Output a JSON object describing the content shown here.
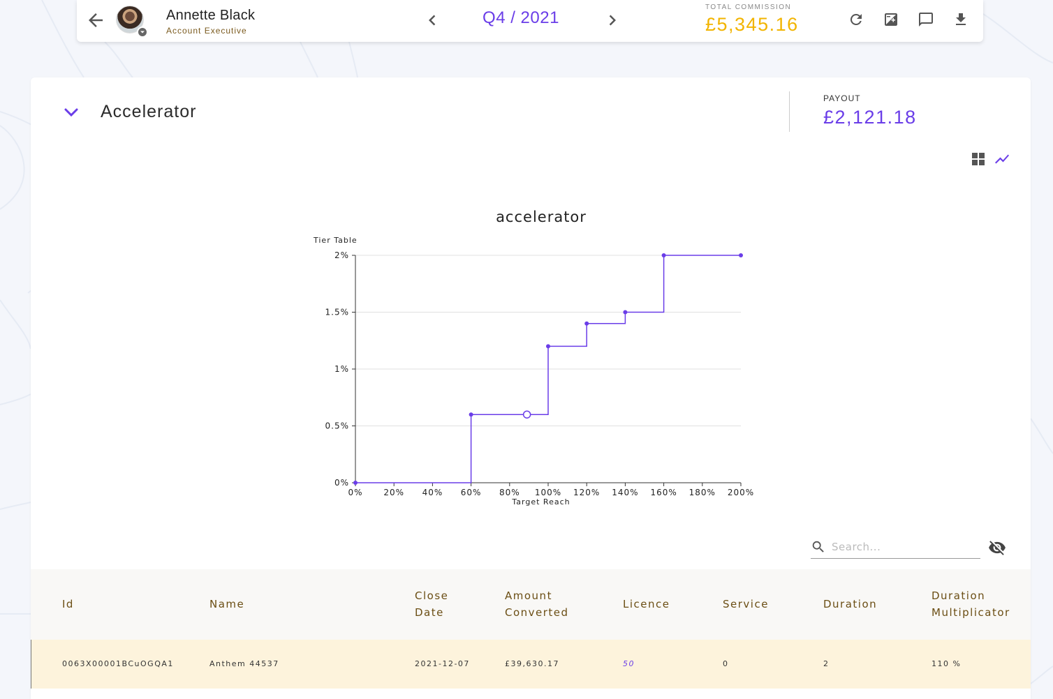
{
  "header": {
    "user_name": "Annette Black",
    "user_role": "Account Executive",
    "period": "Q4 / 2021",
    "total_commission_label": "TOTAL COMMISSION",
    "total_commission_value": "£5,345.16",
    "icons": [
      "back-arrow-icon",
      "avatar",
      "chevron-left-icon",
      "chevron-right-icon",
      "refresh-icon",
      "adjust-icon",
      "comment-icon",
      "download-icon"
    ]
  },
  "section": {
    "title": "Accelerator",
    "payout_label": "PAYOUT",
    "payout_value": "£2,121.18"
  },
  "chart_data": {
    "type": "line",
    "step": true,
    "title": "accelerator",
    "xlabel": "Target Reach",
    "ylabel": "Tier Table",
    "xlim": [
      0,
      200
    ],
    "ylim": [
      0,
      2
    ],
    "x_ticks": [
      "0%",
      "20%",
      "40%",
      "60%",
      "80%",
      "100%",
      "120%",
      "140%",
      "160%",
      "180%",
      "200%"
    ],
    "y_ticks": [
      "0%",
      "0.5%",
      "1%",
      "1.5%",
      "2%"
    ],
    "x_tick_values": [
      0,
      20,
      40,
      60,
      80,
      100,
      120,
      140,
      160,
      180,
      200
    ],
    "y_tick_values": [
      0,
      0.5,
      1,
      1.5,
      2
    ],
    "grid": "horizontal",
    "color": "#6a3de8",
    "series": [
      {
        "x": [
          0,
          60,
          100,
          120,
          140,
          160,
          200
        ],
        "y": [
          0,
          0.6,
          1.2,
          1.4,
          1.5,
          2,
          2
        ]
      }
    ],
    "current_point": {
      "x": 89,
      "y": 0.6
    }
  },
  "search": {
    "placeholder": "Search..."
  },
  "table": {
    "columns": [
      [
        "Id"
      ],
      [
        "Name"
      ],
      [
        "Close",
        "Date"
      ],
      [
        "Amount",
        "Converted"
      ],
      [
        "Licence"
      ],
      [
        "Service"
      ],
      [
        "Duration"
      ],
      [
        "Duration",
        "Multiplicator"
      ]
    ],
    "rows": [
      [
        "0063X00001BCuOGQA1",
        "Anthem 44537",
        "2021-12-07",
        "£39,630.17",
        "50",
        "0",
        "2",
        "110 %"
      ]
    ]
  }
}
